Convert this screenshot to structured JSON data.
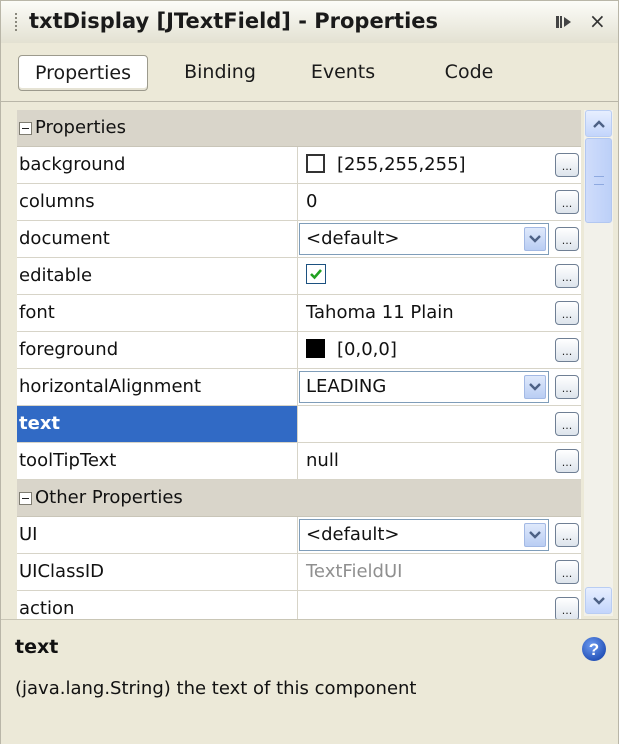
{
  "window": {
    "title": "txtDisplay [JTextField] - Properties",
    "close_glyph": "×"
  },
  "tabs": [
    {
      "label": "Properties",
      "active": true
    },
    {
      "label": "Binding",
      "active": false
    },
    {
      "label": "Events",
      "active": false
    },
    {
      "label": "Code",
      "active": false
    }
  ],
  "categories": {
    "properties": "Properties",
    "other": "Other Properties"
  },
  "rows": {
    "background": {
      "name": "background",
      "value": "[255,255,255]",
      "swatch_color": "#ffffff"
    },
    "columns": {
      "name": "columns",
      "value": "0"
    },
    "document": {
      "name": "document",
      "value": "<default>"
    },
    "editable": {
      "name": "editable",
      "checked": true
    },
    "font": {
      "name": "font",
      "value": "Tahoma 11 Plain"
    },
    "foreground": {
      "name": "foreground",
      "value": "[0,0,0]",
      "swatch_color": "#000000"
    },
    "horizontalAlignment": {
      "name": "horizontalAlignment",
      "value": "LEADING"
    },
    "text": {
      "name": "text",
      "value": "",
      "selected": true
    },
    "toolTipText": {
      "name": "toolTipText",
      "value": "null"
    },
    "ui": {
      "name": "UI",
      "value": "<default>"
    },
    "uiClassID": {
      "name": "UIClassID",
      "value": "TextFieldUI"
    },
    "action": {
      "name": "action",
      "value": ""
    }
  },
  "ellipsis_glyph": "...",
  "description": {
    "title": "text",
    "text": "(java.lang.String) the text of this component"
  },
  "colors": {
    "selection": "#316ac5",
    "panel_bg": "#ece9d8",
    "category_bg": "#d9d5ca",
    "help_icon": "#2f63c7"
  }
}
